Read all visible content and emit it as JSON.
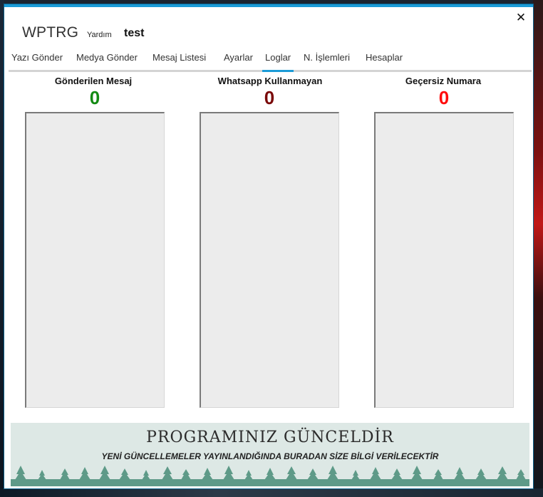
{
  "window": {
    "app_title": "WPTRG",
    "help_label": "Yardım",
    "user_name": "test",
    "close_glyph": "✕",
    "accent_color": "#1b9bd7"
  },
  "tabs": [
    {
      "label": "Yazı Gönder"
    },
    {
      "label": "Medya Gönder"
    },
    {
      "label": "Mesaj Listesi"
    },
    {
      "label": "Ayarlar"
    },
    {
      "label": "Loglar",
      "active": true
    },
    {
      "label": "N. İşlemleri"
    },
    {
      "label": "Hesaplar"
    }
  ],
  "stats": [
    {
      "title": "Gönderilen Mesaj",
      "value": "0",
      "color": "#138a13"
    },
    {
      "title": "Whatsapp Kullanmayan",
      "value": "0",
      "color": "#7a0a0a"
    },
    {
      "title": "Geçersiz Numara",
      "value": "0",
      "color": "#ff0d0d"
    }
  ],
  "banner": {
    "title": "PROGRAMINIZ GÜNCELDİR",
    "subtitle": "YENİ GÜNCELLEMELER YAYINLANDIĞINDA BURADAN SİZE BİLGİ VERİLECEKTİR",
    "color": "#5e9a88"
  }
}
